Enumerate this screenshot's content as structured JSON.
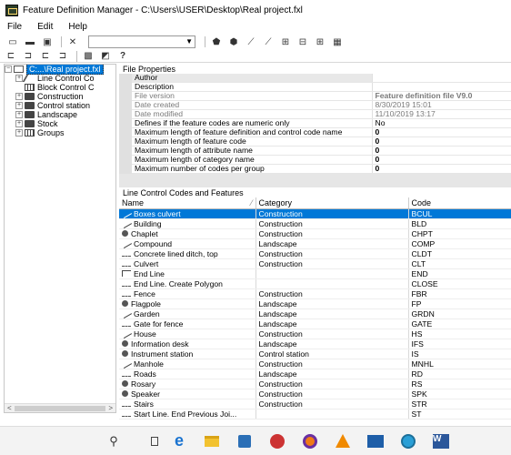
{
  "window": {
    "title": "Feature Definition Manager - C:\\Users\\USER\\Desktop\\Real project.fxl"
  },
  "menu": [
    "File",
    "Edit",
    "Help"
  ],
  "toolbar": {
    "help_label": "?"
  },
  "tree": {
    "root": "C:...\\Real project.fxl",
    "items": [
      {
        "label": "Line Control Co",
        "icon": "line-control-icon",
        "expandable": true
      },
      {
        "label": "Block Control C",
        "icon": "block-control-icon",
        "expandable": false
      },
      {
        "label": "Construction",
        "icon": "folder-icon",
        "expandable": true
      },
      {
        "label": "Control station",
        "icon": "folder-icon",
        "expandable": true
      },
      {
        "label": "Landscape",
        "icon": "folder-icon",
        "expandable": true
      },
      {
        "label": "Stock",
        "icon": "folder-icon",
        "expandable": true
      },
      {
        "label": "Groups",
        "icon": "groups-icon",
        "expandable": true
      }
    ]
  },
  "file_properties": {
    "header": "File Properties",
    "rows": [
      {
        "key": "Author",
        "value": "",
        "style": "normal"
      },
      {
        "key": "Description",
        "value": "",
        "style": "normal"
      },
      {
        "key": "File version",
        "value": "Feature definition file V9.0",
        "style": "grey-bold"
      },
      {
        "key": "Date created",
        "value": "8/30/2019 15:01",
        "style": "grey"
      },
      {
        "key": "Date modified",
        "value": "11/10/2019 13:17",
        "style": "grey"
      },
      {
        "key": "Defines if the feature codes are numeric only",
        "value": "No",
        "style": "normal"
      },
      {
        "key": "Maximum length of feature definition and control code name",
        "value": "0",
        "style": "bold"
      },
      {
        "key": "Maximum length of feature code",
        "value": "0",
        "style": "bold"
      },
      {
        "key": "Maximum length of attribute name",
        "value": "0",
        "style": "bold"
      },
      {
        "key": "Maximum length of category name",
        "value": "0",
        "style": "bold"
      },
      {
        "key": "Maximum number of codes per group",
        "value": "0",
        "style": "bold"
      }
    ]
  },
  "codes": {
    "header": "Line Control Codes and Features",
    "columns": [
      "Name",
      "Category",
      "Code"
    ],
    "rows": [
      {
        "name": "Boxes culvert",
        "category": "Construction",
        "code": "BCUL",
        "icon": "line",
        "selected": true
      },
      {
        "name": "Building",
        "category": "Construction",
        "code": "BLD",
        "icon": "line"
      },
      {
        "name": "Chaplet",
        "category": "Construction",
        "code": "CHPT",
        "icon": "point"
      },
      {
        "name": "Compound",
        "category": "Landscape",
        "code": "COMP",
        "icon": "line"
      },
      {
        "name": "Concrete lined ditch, top",
        "category": "Construction",
        "code": "CLDT",
        "icon": "dash"
      },
      {
        "name": "Culvert",
        "category": "Construction",
        "code": "CLT",
        "icon": "dash"
      },
      {
        "name": "End Line",
        "category": "",
        "code": "END",
        "icon": "poly"
      },
      {
        "name": "End Line. Create Polygon",
        "category": "",
        "code": "CLOSE",
        "icon": "dash"
      },
      {
        "name": "Fence",
        "category": "Construction",
        "code": "FBR",
        "icon": "dash"
      },
      {
        "name": "Flagpole",
        "category": "Landscape",
        "code": "FP",
        "icon": "point"
      },
      {
        "name": "Garden",
        "category": "Landscape",
        "code": "GRDN",
        "icon": "line"
      },
      {
        "name": "Gate for fence",
        "category": "Landscape",
        "code": "GATE",
        "icon": "dash"
      },
      {
        "name": "House",
        "category": "Construction",
        "code": "HS",
        "icon": "line"
      },
      {
        "name": "Information desk",
        "category": "Landscape",
        "code": "IFS",
        "icon": "point"
      },
      {
        "name": "Instrument station",
        "category": "Control station",
        "code": "IS",
        "icon": "point"
      },
      {
        "name": "Manhole",
        "category": "Construction",
        "code": "MNHL",
        "icon": "line"
      },
      {
        "name": "Roads",
        "category": "Landscape",
        "code": "RD",
        "icon": "dash"
      },
      {
        "name": "Rosary",
        "category": "Construction",
        "code": "RS",
        "icon": "point"
      },
      {
        "name": "Speaker",
        "category": "Construction",
        "code": "SPK",
        "icon": "point"
      },
      {
        "name": "Stairs",
        "category": "Construction",
        "code": "STR",
        "icon": "dash"
      },
      {
        "name": "Start Line. End Previous Joi...",
        "category": "",
        "code": "ST",
        "icon": "dash"
      }
    ]
  }
}
